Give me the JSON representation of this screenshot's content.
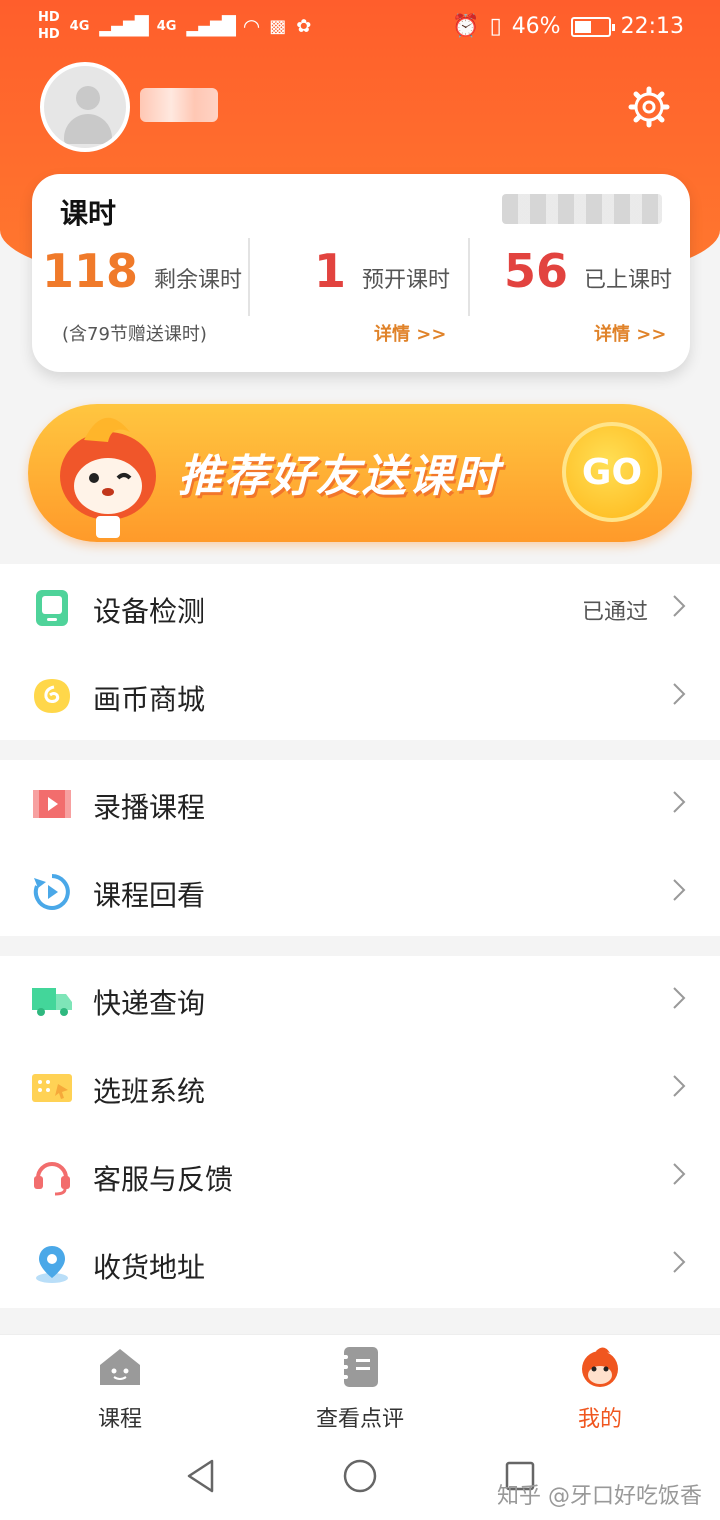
{
  "status_bar": {
    "carrier_labels": [
      "HD",
      "HD"
    ],
    "network": [
      "4G",
      "4G"
    ],
    "battery": "46%",
    "battery_level": 0.46,
    "time": "22:13"
  },
  "profile": {
    "settings_icon": "gear-icon"
  },
  "card": {
    "title": "课时",
    "stats": [
      {
        "value": "118",
        "label": "剩余课时",
        "color": "#f07a2a"
      },
      {
        "value": "1",
        "label": "预开课时",
        "color": "#e2433f"
      },
      {
        "value": "56",
        "label": "已上课时",
        "color": "#e2433f"
      }
    ],
    "gift_note": "(含79节赠送课时)",
    "detail_link": "详情 >>",
    "detail_link_2": "详情 >>"
  },
  "banner": {
    "text": "推荐好友送课时",
    "go": "GO"
  },
  "menu": {
    "group1": [
      {
        "label": "设备检测",
        "status": "已通过",
        "icon": "device-icon"
      },
      {
        "label": "画币商城",
        "status": "",
        "icon": "coin-icon"
      }
    ],
    "group2": [
      {
        "label": "录播课程",
        "icon": "video-icon"
      },
      {
        "label": "课程回看",
        "icon": "replay-icon"
      }
    ],
    "group3": [
      {
        "label": "快递查询",
        "icon": "truck-icon"
      },
      {
        "label": "选班系统",
        "icon": "ticket-icon"
      },
      {
        "label": "客服与反馈",
        "icon": "headset-icon"
      },
      {
        "label": "收货地址",
        "icon": "location-icon"
      }
    ]
  },
  "tabs": [
    {
      "label": "课程",
      "icon": "house-icon"
    },
    {
      "label": "查看点评",
      "icon": "notebook-icon"
    },
    {
      "label": "我的",
      "icon": "mascot-icon",
      "active": true
    }
  ],
  "watermark": "知乎 @牙口好吃饭香",
  "colors": {
    "accent": "#ff6a2c",
    "link": "#e0832a",
    "active_tab": "#f0561f"
  }
}
